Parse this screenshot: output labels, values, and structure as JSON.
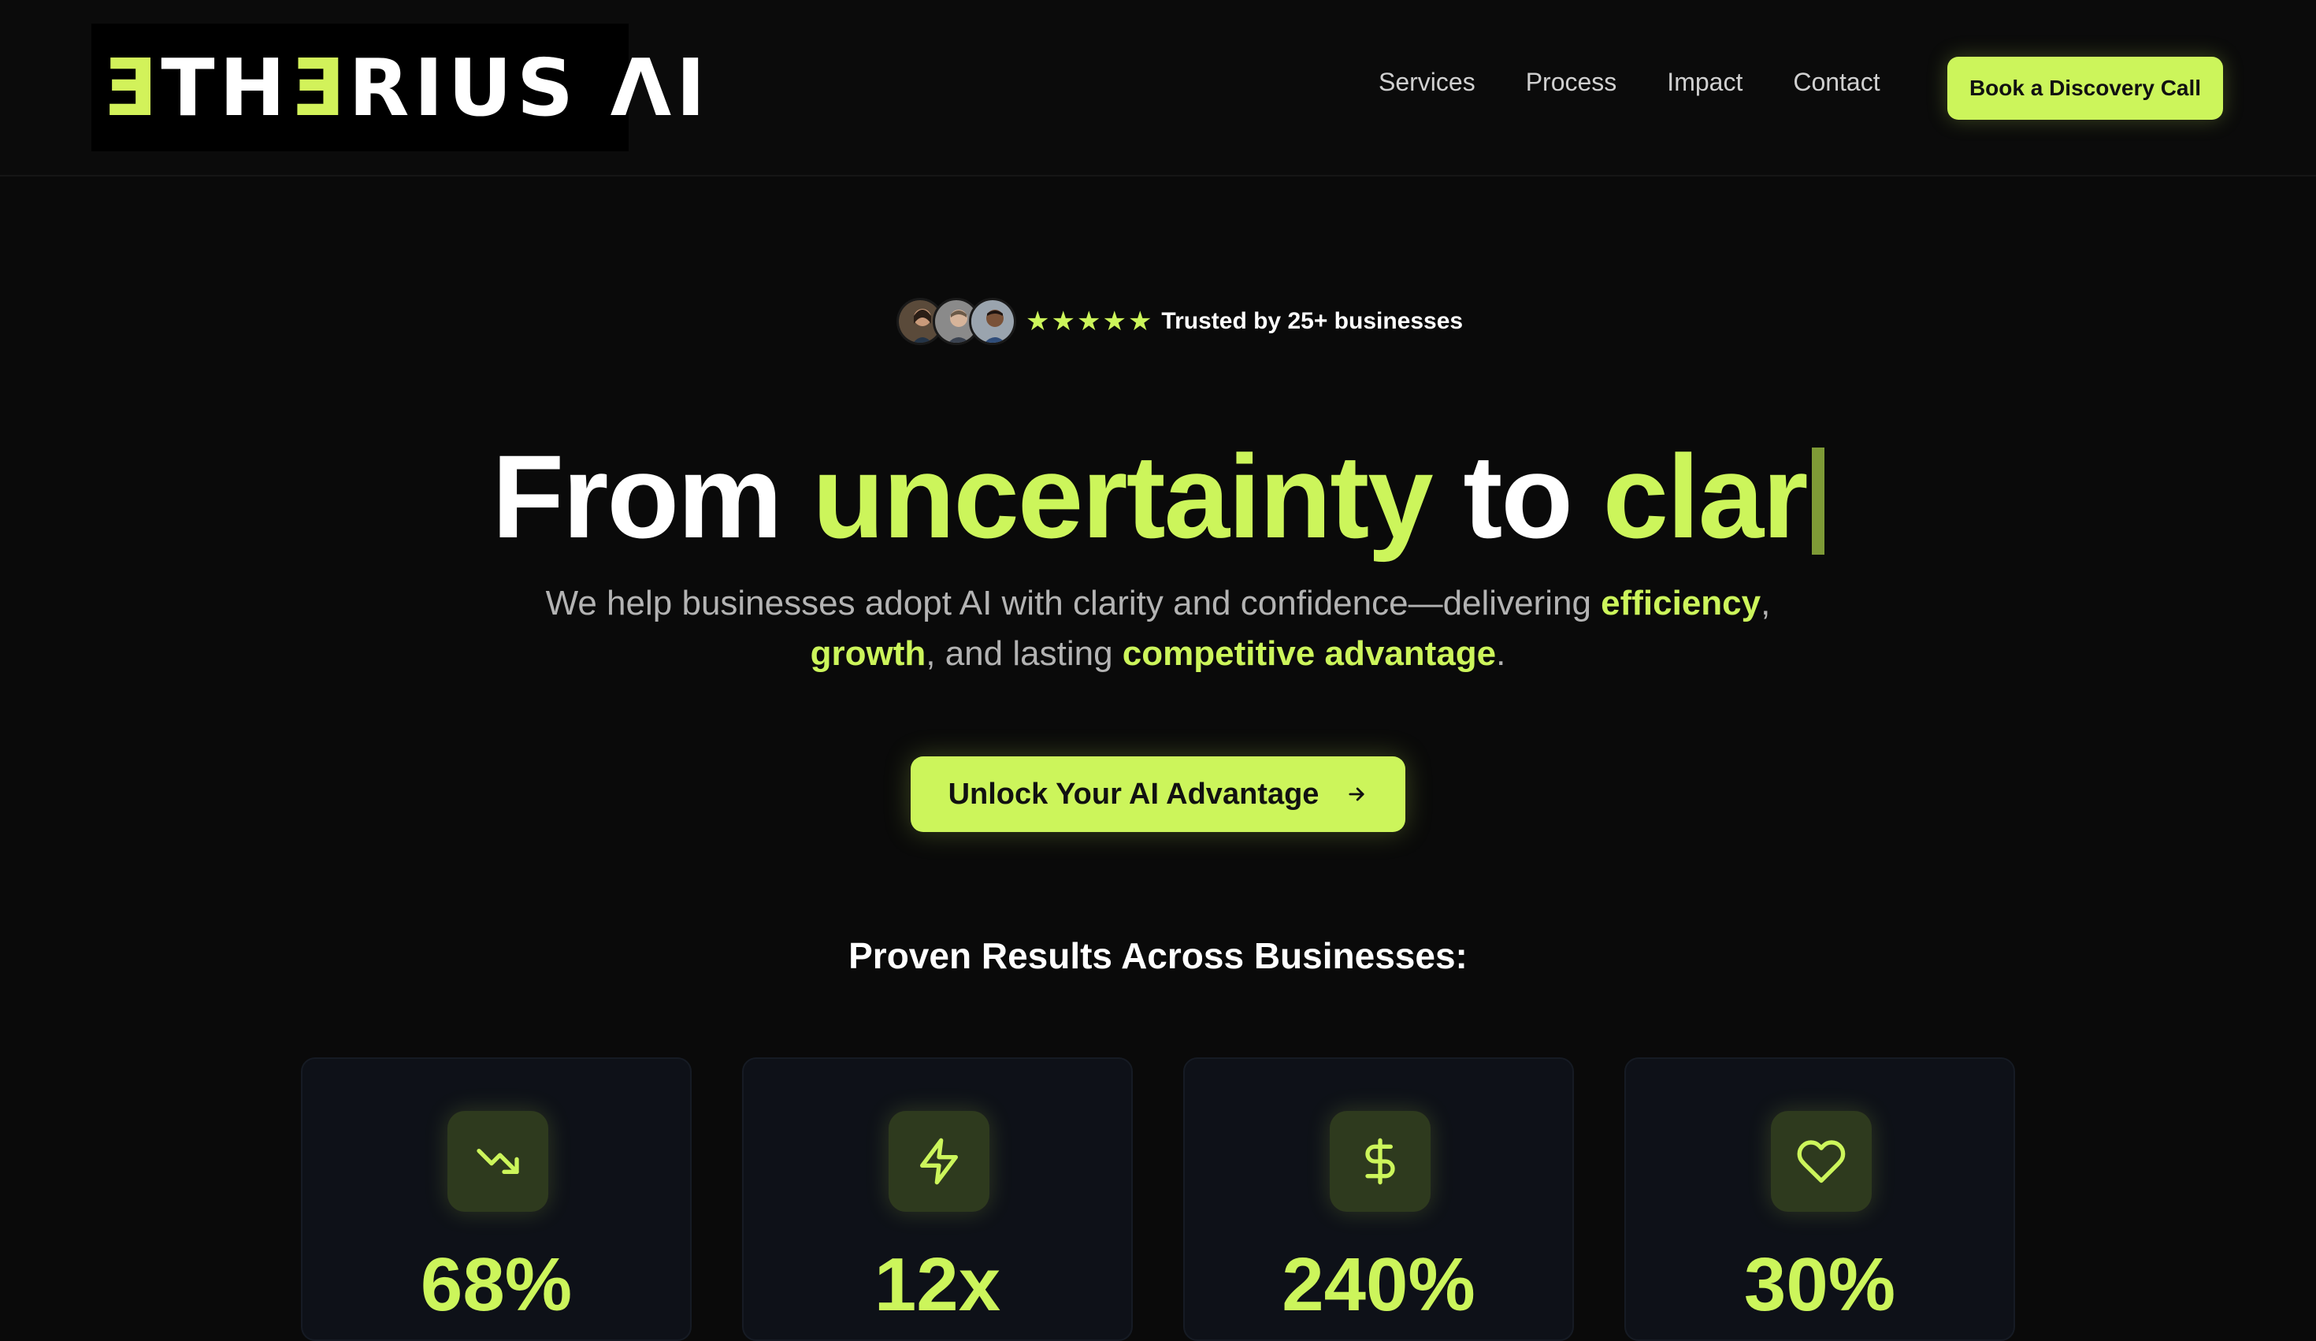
{
  "header": {
    "logo": {
      "prefix": "Ǝ",
      "mid": "TH",
      "e2": "Ǝ",
      "rest": "RIUS ",
      "ai": "ΛI"
    },
    "nav": [
      "Services",
      "Process",
      "Impact",
      "Contact"
    ],
    "cta_label": "Book a Discovery Call"
  },
  "trust": {
    "text": "Trusted by 25+ businesses",
    "stars": 5,
    "avatars": 3
  },
  "hero": {
    "headline_part1": "From ",
    "headline_lime1": "uncertainty",
    "headline_part2": " to ",
    "headline_lime2": "clar",
    "sub_part1": "We help businesses adopt AI with clarity and confidence—delivering ",
    "sub_hl1": "efficiency",
    "sub_part2": ",",
    "sub_hl2": "growth",
    "sub_part3": ", and lasting ",
    "sub_hl3": "competitive advantage",
    "sub_part4": ".",
    "cta_label": "Unlock Your AI Advantage",
    "cta_icon": "arrow-right-icon"
  },
  "results": {
    "title": "Proven Results Across Businesses:",
    "cards": [
      {
        "icon": "trending-down-icon",
        "value": "68%"
      },
      {
        "icon": "lightning-icon",
        "value": "12x"
      },
      {
        "icon": "dollar-icon",
        "value": "240%"
      },
      {
        "icon": "heart-icon",
        "value": "30%"
      }
    ]
  },
  "colors": {
    "accent": "#ccf55b",
    "background": "#0a0a0a",
    "card": "#0e1118"
  }
}
